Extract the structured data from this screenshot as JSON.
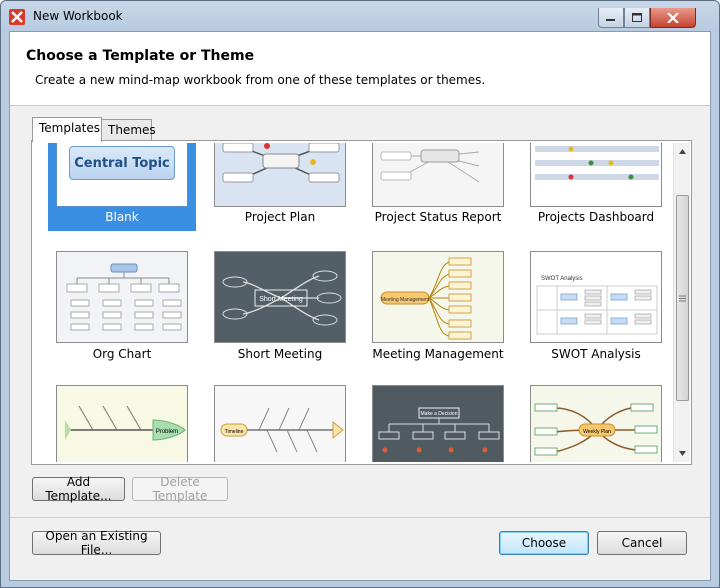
{
  "window": {
    "title": "New Workbook"
  },
  "header": {
    "title": "Choose a Template or Theme",
    "description": "Create a new mind-map workbook from one of these templates or themes."
  },
  "tabs": [
    {
      "label": "Templates",
      "active": true
    },
    {
      "label": "Themes",
      "active": false
    }
  ],
  "templates": [
    {
      "label": "Blank",
      "selected": true,
      "thumb_text": "Central Topic"
    },
    {
      "label": "Project Plan",
      "selected": false,
      "thumb_text": "Project Plan"
    },
    {
      "label": "Project Status Report",
      "selected": false,
      "thumb_text": "Project Status"
    },
    {
      "label": "Projects Dashboard",
      "selected": false
    },
    {
      "label": "Org Chart",
      "selected": false
    },
    {
      "label": "Short Meeting",
      "selected": false,
      "thumb_text": "Short Meeting"
    },
    {
      "label": "Meeting Management",
      "selected": false,
      "thumb_text": "Meeting Management"
    },
    {
      "label": "SWOT Analysis",
      "selected": false,
      "thumb_text": "SWOT Analysis"
    },
    {
      "label": "",
      "selected": false,
      "thumb_text": "Problem"
    },
    {
      "label": "",
      "selected": false,
      "thumb_text": "Timeline"
    },
    {
      "label": "",
      "selected": false,
      "thumb_text": "Make a Decision"
    },
    {
      "label": "",
      "selected": false,
      "thumb_text": "Weekly Plan"
    }
  ],
  "buttons": {
    "add_template": "Add Template...",
    "delete_template": "Delete Template",
    "open_existing": "Open an Existing File...",
    "choose": "Choose",
    "cancel": "Cancel"
  },
  "colors": {
    "selection": "#3b8fe3",
    "accent": "#3c7fb1"
  }
}
